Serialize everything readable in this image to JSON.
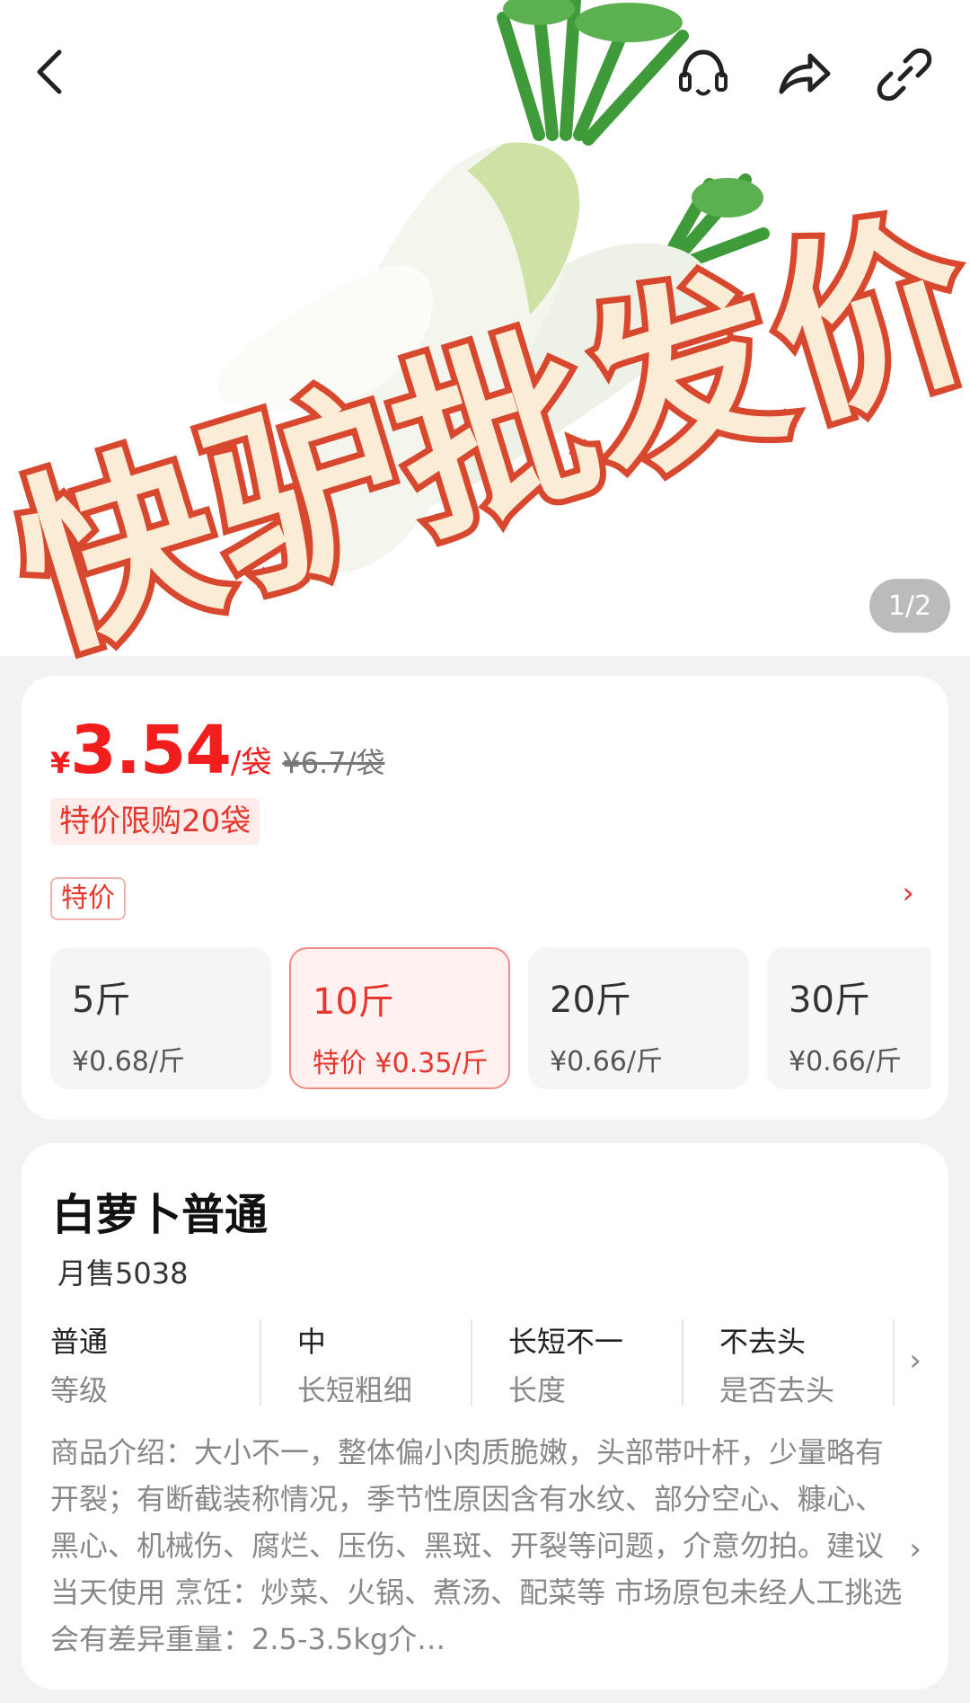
{
  "header": {
    "page_indicator": "1/2"
  },
  "watermark": {
    "text": "快驴批发价"
  },
  "price": {
    "currency": "¥",
    "value": "3.54",
    "unit": "/袋",
    "original": "¥6.7/袋",
    "limit_tag": "特价限购20袋",
    "special_badge": "特价"
  },
  "specs": [
    {
      "weight": "5斤",
      "price": "¥0.68/斤",
      "selected": false
    },
    {
      "weight": "10斤",
      "price": "特价 ¥0.35/斤",
      "selected": true
    },
    {
      "weight": "20斤",
      "price": "¥0.66/斤",
      "selected": false
    },
    {
      "weight": "30斤",
      "price": "¥0.66/斤",
      "selected": false
    }
  ],
  "product": {
    "title": "白萝卜普通",
    "monthly_sales": "月售5038",
    "attributes": [
      {
        "value": "普通",
        "key": "等级"
      },
      {
        "value": "中",
        "key": "长短粗细"
      },
      {
        "value": "长短不一",
        "key": "长度"
      },
      {
        "value": "不去头",
        "key": "是否去头"
      }
    ],
    "description": "商品介绍：大小不一，整体偏小肉质脆嫩，头部带叶杆，少量略有开裂；有断截装称情况，季节性原因含有水纹、部分空心、糠心、黑心、机械伤、腐烂、压伤、黑斑、开裂等问题，介意勿拍。建议当天使用 烹饪：炒菜、火锅、煮汤、配菜等 市场原包未经人工挑选会有差异重量：2.5-3.5kg介…"
  },
  "colors": {
    "accent": "#e5372d",
    "price_red": "#f21d1d",
    "watermark_fill": "#fbecd5",
    "watermark_stroke": "#d8482e"
  }
}
